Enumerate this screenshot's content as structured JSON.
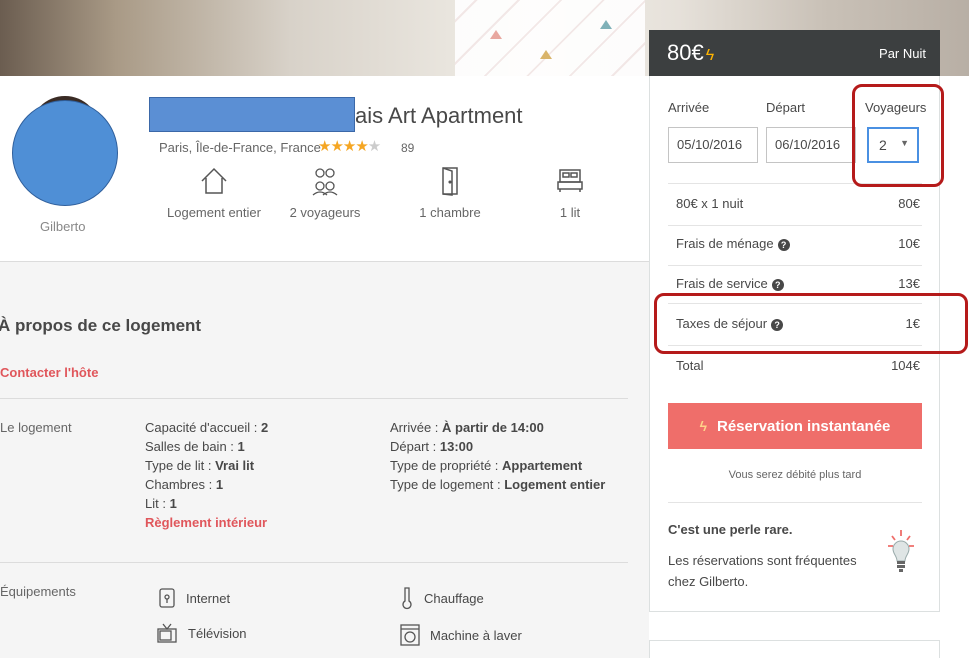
{
  "listing": {
    "title": "ais Art Apartment",
    "location": "Paris, Île-de-France, France",
    "stars_full": "★★★★",
    "stars_dim": "★",
    "reviews": "89",
    "host_name": "Gilberto"
  },
  "features": [
    {
      "label": "Logement entier",
      "icon": "house-icon"
    },
    {
      "label": "2 voyageurs",
      "icon": "guests-icon"
    },
    {
      "label": "1 chambre",
      "icon": "door-icon"
    },
    {
      "label": "1 lit",
      "icon": "bed-icon"
    }
  ],
  "about": {
    "title": "À propos de ce logement",
    "contact": "Contacter l'hôte",
    "space_label": "Le logement",
    "col1": [
      {
        "k": "Capacité d'accueil : ",
        "v": "2"
      },
      {
        "k": "Salles de bain : ",
        "v": "1"
      },
      {
        "k": "Type de lit : ",
        "v": "Vrai lit"
      },
      {
        "k": "Chambres : ",
        "v": "1"
      },
      {
        "k": "Lit : ",
        "v": "1"
      }
    ],
    "rules_link": "Règlement intérieur",
    "col2": [
      {
        "k": "Arrivée : ",
        "v": "À partir de 14:00"
      },
      {
        "k": "Départ : ",
        "v": "13:00"
      },
      {
        "k": "Type de propriété : ",
        "v": "Appartement"
      },
      {
        "k": "Type de logement : ",
        "v": "Logement entier"
      }
    ],
    "amenities_label": "Équipements",
    "amenities": [
      {
        "label": "Internet",
        "icon": "wifi-icon"
      },
      {
        "label": "Chauffage",
        "icon": "thermometer-icon"
      },
      {
        "label": "Télévision",
        "icon": "tv-icon"
      },
      {
        "label": "Machine à laver",
        "icon": "washer-icon"
      }
    ]
  },
  "booking": {
    "price": "80€",
    "per_night": "Par Nuit",
    "checkin_label": "Arrivée",
    "checkout_label": "Départ",
    "guests_label": "Voyageurs",
    "checkin": "05/10/2016",
    "checkout": "06/10/2016",
    "guests": "2",
    "lines": [
      {
        "label": "80€ x 1 nuit",
        "value": "80€",
        "help": false
      },
      {
        "label": "Frais de ménage",
        "value": "10€",
        "help": true
      },
      {
        "label": "Frais de service",
        "value": "13€",
        "help": true
      },
      {
        "label": "Taxes de séjour",
        "value": "1€",
        "help": true
      },
      {
        "label": "Total",
        "value": "104€",
        "help": false
      }
    ],
    "button": "Réservation instantanée",
    "debit_note": "Vous serez débité plus tard",
    "gem_title": "C'est une perle rare.",
    "gem_text": "Les réservations sont fréquentes chez Gilberto."
  },
  "colors": {
    "accent": "#ef6e6a",
    "link": "#e0565b",
    "star": "#f5a623",
    "annotation": "#b51a1a"
  }
}
